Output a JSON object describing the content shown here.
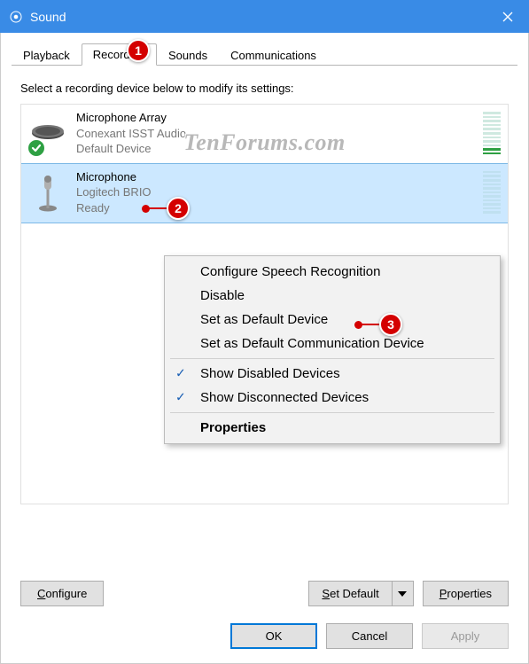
{
  "window": {
    "title": "Sound",
    "close_label": "Close"
  },
  "tabs": [
    {
      "label": "Playback",
      "active": false
    },
    {
      "label": "Recording",
      "active": true
    },
    {
      "label": "Sounds",
      "active": false
    },
    {
      "label": "Communications",
      "active": false
    }
  ],
  "instruction": "Select a recording device below to modify its settings:",
  "devices": [
    {
      "name": "Microphone Array",
      "subtitle": "Conexant ISST Audio",
      "status": "Default Device",
      "is_default": true,
      "selected": false,
      "level_on_segments": 2,
      "level_total_segments": 11,
      "icon": "mic-array"
    },
    {
      "name": "Microphone",
      "subtitle": "Logitech BRIO",
      "status": "Ready",
      "is_default": false,
      "selected": true,
      "level_on_segments": 0,
      "level_total_segments": 11,
      "icon": "mic-stand"
    }
  ],
  "context_menu": {
    "items": [
      {
        "label": "Configure Speech Recognition",
        "checked": false,
        "bold": false
      },
      {
        "label": "Disable",
        "checked": false,
        "bold": false
      },
      {
        "label": "Set as Default Device",
        "checked": false,
        "bold": false
      },
      {
        "label": "Set as Default Communication Device",
        "checked": false,
        "bold": false
      }
    ],
    "items2": [
      {
        "label": "Show Disabled Devices",
        "checked": true,
        "bold": false
      },
      {
        "label": "Show Disconnected Devices",
        "checked": true,
        "bold": false
      }
    ],
    "items3": [
      {
        "label": "Properties",
        "checked": false,
        "bold": true
      }
    ]
  },
  "group_buttons": {
    "configure": {
      "accel": "C",
      "rest": "onfigure"
    },
    "set_default": {
      "accel": "S",
      "rest": "et Default"
    },
    "properties": {
      "accel": "P",
      "rest": "roperties"
    }
  },
  "dialog_buttons": {
    "ok": "OK",
    "cancel": "Cancel",
    "apply": "Apply"
  },
  "callouts": {
    "1": "1",
    "2": "2",
    "3": "3"
  },
  "watermark": "TenForums.com"
}
